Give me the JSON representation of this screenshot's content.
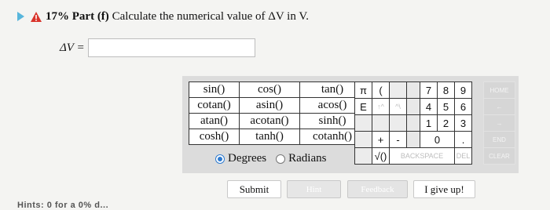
{
  "question": {
    "percent": "17%",
    "part": "Part (f)",
    "prompt": "Calculate the numerical value of ΔV in V."
  },
  "answer": {
    "label": "ΔV =",
    "value": ""
  },
  "functions": {
    "rows": [
      [
        "sin()",
        "cos()",
        "tan()"
      ],
      [
        "cotan()",
        "asin()",
        "acos()"
      ],
      [
        "atan()",
        "acotan()",
        "sinh()"
      ],
      [
        "cosh()",
        "tanh()",
        "cotanh()"
      ]
    ],
    "degrees": "Degrees",
    "radians": "Radians",
    "selected": "Degrees"
  },
  "keys": {
    "pi": "π",
    "open_paren": "(",
    "e": "E",
    "up": "↑^",
    "caret": "^\\",
    "d7": "7",
    "d8": "8",
    "d9": "9",
    "d4": "4",
    "d5": "5",
    "d6": "6",
    "d1": "1",
    "d2": "2",
    "d3": "3",
    "plus": "+",
    "minus": "-",
    "d0": "0",
    "dot": ".",
    "sqrt": "√()",
    "backspace": "BACKSPACE",
    "del": "DEL"
  },
  "side": {
    "home": "HOME",
    "end": "END",
    "clear": "CLEAR"
  },
  "buttons": {
    "submit": "Submit",
    "hint": "Hint",
    "feedback": "Feedback",
    "give_up": "I give up!"
  },
  "footer": {
    "hints": "Hints: 0 for a 0% d..."
  },
  "colors": {
    "play_icon": "#58b6dc",
    "warning_icon": "#d9342b",
    "radio_selected": "#2e7bd0"
  }
}
